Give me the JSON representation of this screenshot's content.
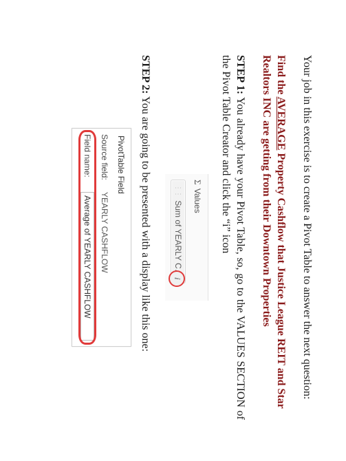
{
  "intro": "Your job in this exercise is to create a Pivot Table to answer the next question:",
  "question": {
    "prefix": "Find the ",
    "avg": "AVERAGE",
    "rest": " Property Cashflow that Justice League REIT and Star Realtors INC are getting from their Downtown Properties"
  },
  "step1": {
    "label": "STEP 1:",
    "text": " You already have your Pivot Table, so, go to the VALUES SECTION of the Pivot Table Creator and click the “i” icon"
  },
  "fig1": {
    "header": "Values",
    "pill": "Sum of YEARLY C…",
    "info_glyph": "i"
  },
  "step2": {
    "label": "STEP 2:",
    "text": " You are going to be presented with a display like this one:"
  },
  "fig2": {
    "title": "PivotTable Field",
    "source_label": "Source field:",
    "source_value": "YEARLY CASHFLOW",
    "field_label": "Field name:",
    "field_value": "Average of YEARLY CASHFLOW"
  }
}
